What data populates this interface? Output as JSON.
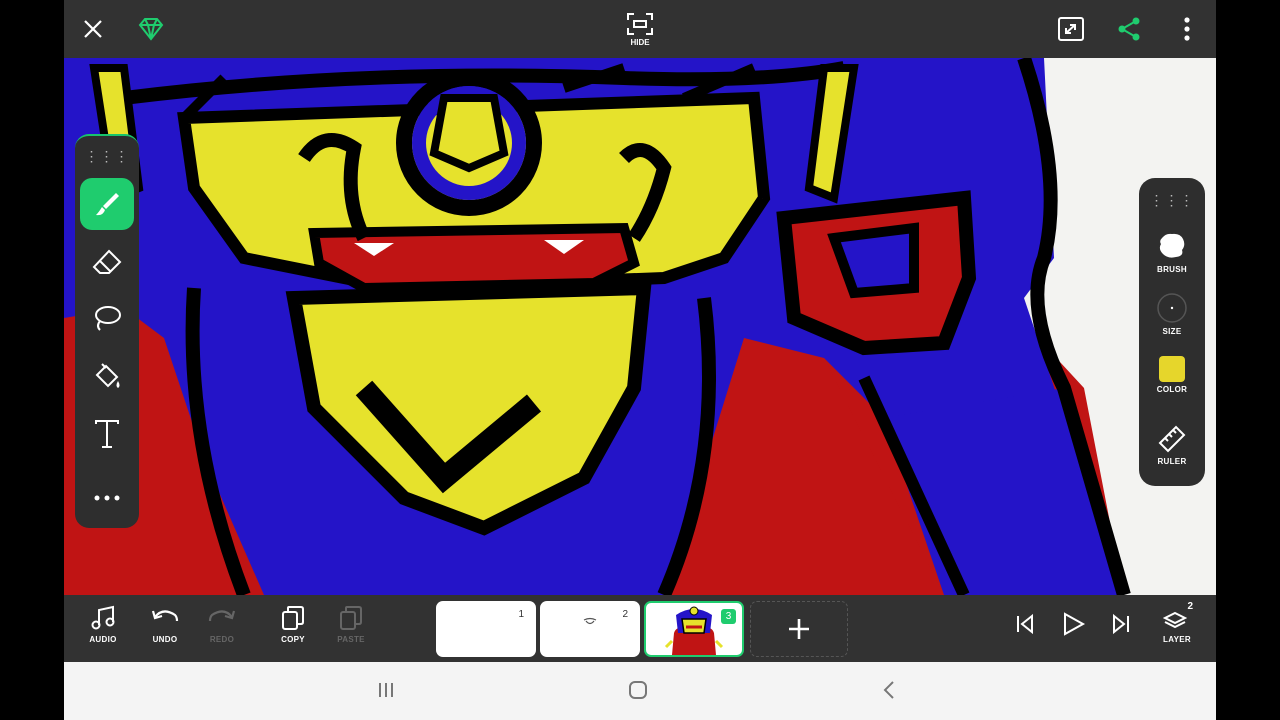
{
  "topbar": {
    "hide_label": "HIDE"
  },
  "left_tools": [
    "brush",
    "eraser",
    "lasso",
    "fill",
    "text",
    "more"
  ],
  "right_tools": {
    "brush_label": "BRUSH",
    "size_label": "SIZE",
    "color_label": "COLOR",
    "ruler_label": "RULER",
    "current_color": "#e6d62b"
  },
  "bottombar": {
    "audio_label": "AUDIO",
    "undo_label": "UNDO",
    "redo_label": "REDO",
    "copy_label": "COPY",
    "paste_label": "PASTE",
    "layer_label": "LAYER",
    "layer_count": "2"
  },
  "frames": [
    {
      "num": "1"
    },
    {
      "num": "2"
    },
    {
      "num": "3"
    }
  ],
  "colors": {
    "accent": "#1fcc6e",
    "yellow": "#e6e22c",
    "blue": "#2414c8",
    "red": "#c01414"
  }
}
